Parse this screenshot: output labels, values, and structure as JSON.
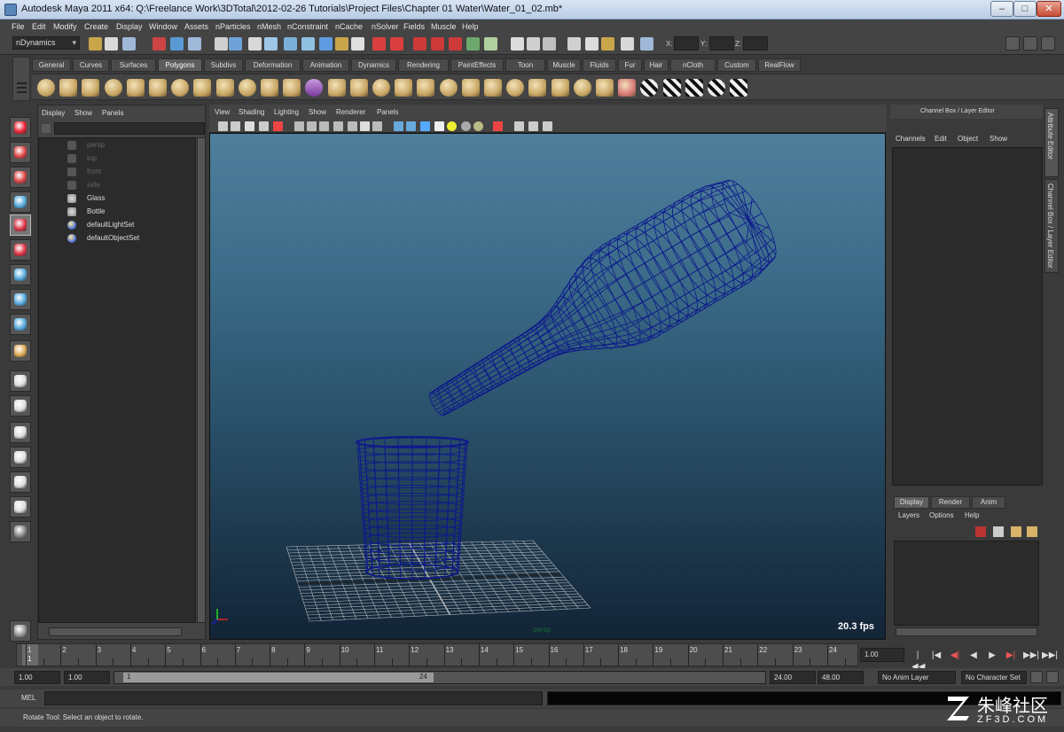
{
  "window": {
    "title": "Autodesk Maya 2011 x64: Q:\\Freelance Work\\3DTotal\\2012-02-26 Tutorials\\Project Files\\Chapter 01 Water\\Water_01_02.mb*",
    "minimize": "–",
    "maximize": "□",
    "close": "✕"
  },
  "menubar": [
    "File",
    "Edit",
    "Modify",
    "Create",
    "Display",
    "Window",
    "Assets",
    "nParticles",
    "nMesh",
    "nConstraint",
    "nCache",
    "nSolver",
    "Fields",
    "Muscle",
    "Help"
  ],
  "statusline": {
    "mode": "nDynamics",
    "x_label": "X:",
    "y_label": "Y:",
    "z_label": "Z:"
  },
  "shelf": {
    "tabs": [
      "General",
      "Curves",
      "Surfaces",
      "Polygons",
      "Subdivs",
      "Deformation",
      "Animation",
      "Dynamics",
      "Rendering",
      "PaintEffects",
      "Toon",
      "Muscle",
      "Fluids",
      "Fur",
      "Hair",
      "nCloth",
      "Custom",
      "RealFlow"
    ],
    "active_tab": "Polygons"
  },
  "outliner": {
    "menu": [
      "Display",
      "Show",
      "Panels"
    ],
    "items": [
      {
        "label": "persp",
        "icon": "camera-icon",
        "dim": true
      },
      {
        "label": "top",
        "icon": "camera-icon",
        "dim": true
      },
      {
        "label": "front",
        "icon": "camera-icon",
        "dim": true
      },
      {
        "label": "side",
        "icon": "camera-icon",
        "dim": true
      },
      {
        "label": "Glass",
        "icon": "mesh-icon",
        "dim": false
      },
      {
        "label": "Bottle",
        "icon": "mesh-icon",
        "dim": false
      },
      {
        "label": "defaultLightSet",
        "icon": "set-icon",
        "dim": false
      },
      {
        "label": "defaultObjectSet",
        "icon": "set-icon",
        "dim": false
      }
    ]
  },
  "viewport": {
    "menu": [
      "View",
      "Shading",
      "Lighting",
      "Show",
      "Renderer",
      "Panels"
    ],
    "camera": "persp",
    "fps": "20.3 fps",
    "wire_color": "#0d1a8c",
    "grid_color": "#c8c8c8"
  },
  "channelbox": {
    "title": "Channel Box / Layer Editor",
    "menu": [
      "Channels",
      "Edit",
      "Object",
      "Show"
    ]
  },
  "sidetabs": [
    "Attribute Editor",
    "Channel Box / Layer Editor"
  ],
  "layer_editor": {
    "tabs": [
      "Display",
      "Render",
      "Anim"
    ],
    "active_tab": "Display",
    "menu": [
      "Layers",
      "Options",
      "Help"
    ]
  },
  "timeline": {
    "ticks": [
      "1",
      "2",
      "3",
      "4",
      "5",
      "6",
      "7",
      "8",
      "9",
      "10",
      "11",
      "12",
      "13",
      "14",
      "15",
      "16",
      "17",
      "18",
      "19",
      "20",
      "21",
      "22",
      "23",
      "24"
    ],
    "current_frame": "1",
    "current_time_field": "1.00"
  },
  "range": {
    "start_time": "1.00",
    "playback_start": "1.00",
    "range_start": "1",
    "range_end": "24",
    "playback_end": "24.00",
    "end_time": "48.00",
    "anim_layer": "No Anim Layer",
    "character_set": "No Character Set"
  },
  "playback": [
    "|◀◀",
    "|◀",
    "◀|",
    "◀",
    "▶",
    "▶|",
    "▶▶|",
    "▶▶|"
  ],
  "command": {
    "label": "MEL"
  },
  "helpline": "Rotate Tool: Select an object to rotate.",
  "watermark": {
    "cn": "朱峰社区",
    "en": "ZF3D.COM"
  }
}
